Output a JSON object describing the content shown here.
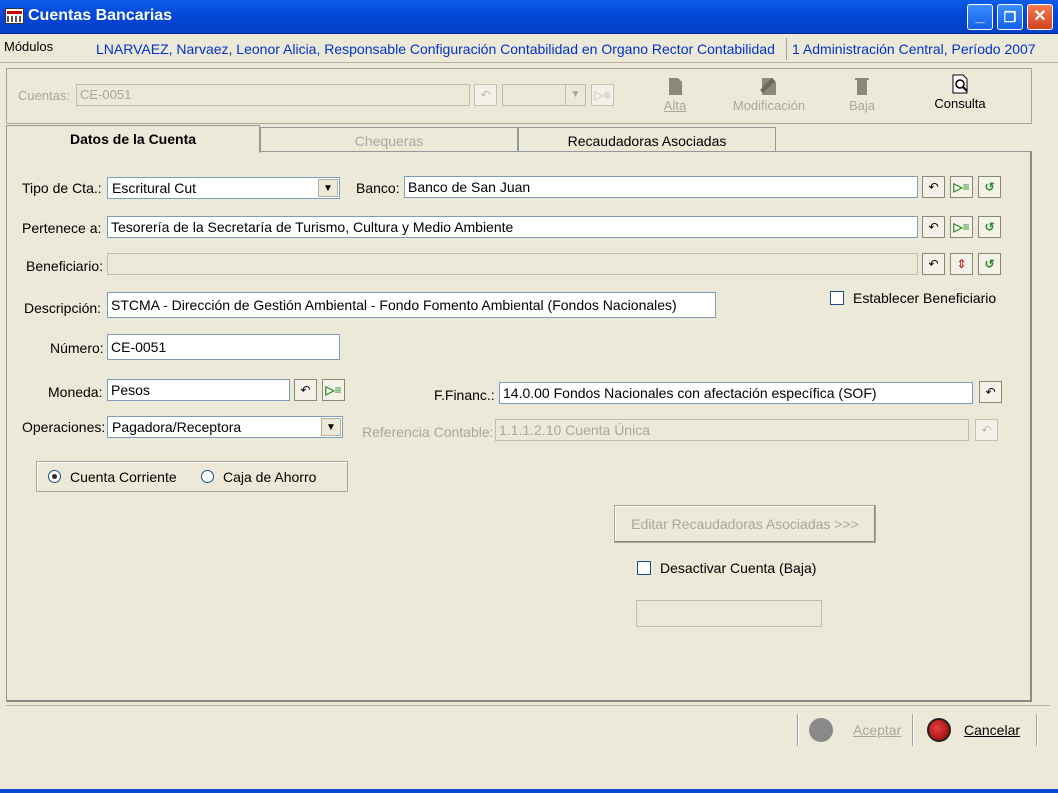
{
  "window": {
    "title": "Cuentas Bancarias"
  },
  "modules": {
    "label": "Módulos",
    "user": "LNARVAEZ, Narvaez, Leonor Alicia, Responsable Configuración Contabilidad en Organo Rector Contabilidad",
    "period": "1 Administración Central, Período 2007"
  },
  "toolbar": {
    "cuentas_label": "Cuentas:",
    "cuentas_value": "CE-0051",
    "alta": "Alta",
    "modificacion": "Modificación",
    "baja": "Baja",
    "consulta": "Consulta"
  },
  "tabs": [
    {
      "label": "Datos de la Cuenta"
    },
    {
      "label": "Chequeras"
    },
    {
      "label": "Recaudadoras Asociadas"
    }
  ],
  "form": {
    "tipo_label": "Tipo de Cta.:",
    "tipo_value": "Escritural Cut",
    "banco_label": "Banco:",
    "banco_value": "Banco de San Juan",
    "pertenece_label": "Pertenece a:",
    "pertenece_value": "Tesorería de la Secretaría de Turismo, Cultura y Medio Ambiente",
    "beneficiario_label": "Beneficiario:",
    "beneficiario_value": "",
    "descripcion_label": "Descripción:",
    "descripcion_value": "STCMA - Dirección de Gestión Ambiental - Fondo Fomento Ambiental (Fondos Nacionales)",
    "establecer_label": "Establecer Beneficiario",
    "numero_label": "Número:",
    "numero_value": "CE-0051",
    "moneda_label": "Moneda:",
    "moneda_value": "Pesos",
    "ffinanc_label": "F.Financ.:",
    "ffinanc_value": "14.0.00 Fondos Nacionales con afectación específica (SOF)",
    "operaciones_label": "Operaciones:",
    "operaciones_value": "Pagadora/Receptora",
    "referencia_label": "Referencia Contable:",
    "referencia_value": "1.1.1.2.10 Cuenta Única",
    "radio_corriente": "Cuenta Corriente",
    "radio_ahorro": "Caja de Ahorro",
    "editar_button": "Editar Recaudadoras Asociadas >>>",
    "desactivar_label": "Desactivar Cuenta (Baja)"
  },
  "footer": {
    "aceptar": "Aceptar",
    "cancelar": "Cancelar"
  },
  "colors": {
    "titlebar": "#0446d8",
    "link_blue": "#0033cc",
    "cancel_red": "#c00000"
  }
}
